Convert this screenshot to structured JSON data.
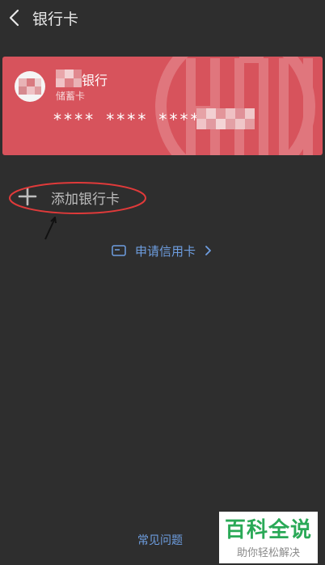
{
  "header": {
    "title": "银行卡"
  },
  "card": {
    "bank_name": "银行",
    "card_type": "储蓄卡",
    "number_masked": "**** **** **** "
  },
  "add_card": {
    "label": "添加银行卡"
  },
  "apply_credit": {
    "label": "申请信用卡"
  },
  "footer": {
    "faq_label": "常见问题"
  },
  "watermark": {
    "title": "百科全说",
    "subtitle": "助你轻松解决"
  },
  "icons": {
    "back": "chevron-left-icon",
    "add": "plus-icon",
    "card": "card-icon",
    "chevron": "chevron-right-icon"
  },
  "colors": {
    "background": "#2e2e2e",
    "card": "#d7535c",
    "link": "#6e9ee0",
    "annotation": "#e03a3a",
    "watermark_green": "#2aa957"
  }
}
